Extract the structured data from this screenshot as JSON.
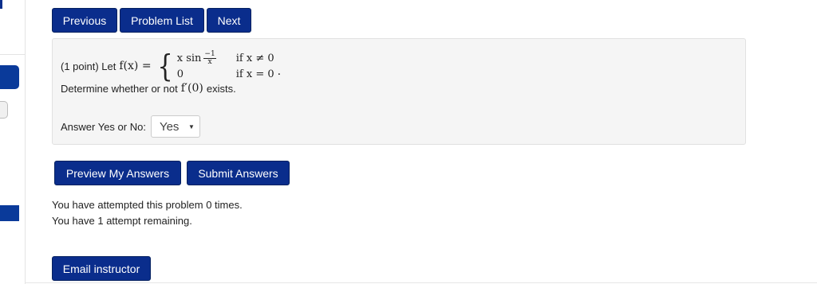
{
  "nav": {
    "previous": "Previous",
    "problem_list": "Problem List",
    "next": "Next"
  },
  "problem": {
    "points_label": "(1 point) Let",
    "function_lhs": "f(x) =",
    "case1_expr": "x sin",
    "case1_frac_num": "−1",
    "case1_frac_den": "x",
    "case1_cond": "if  x ≠ 0",
    "case2_expr": "0",
    "case2_cond": "if  x = 0",
    "period": ".",
    "question_text": "Determine whether or not",
    "question_math": "f′(0)",
    "question_end": "exists."
  },
  "answer": {
    "label": "Answer Yes or No:",
    "selected": "Yes"
  },
  "actions": {
    "preview": "Preview My Answers",
    "submit": "Submit Answers"
  },
  "status": {
    "attempted": "You have attempted this problem 0 times.",
    "remaining": "You have 1 attempt remaining."
  },
  "email": {
    "label": "Email instructor"
  },
  "colors": {
    "button_bg": "#0a2d8c",
    "panel_bg": "#f5f5f5"
  }
}
